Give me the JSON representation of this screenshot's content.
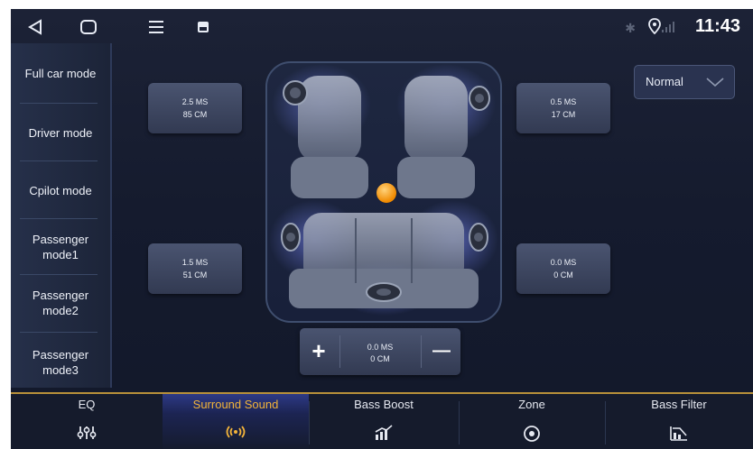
{
  "status_bar": {
    "time": "11:43",
    "back_icon": "back-triangle-icon",
    "home_icon": "home-square-icon",
    "menu_icon": "hamburger-menu-icon",
    "app_icon": "app-thumbnail-icon",
    "bluetooth_icon": "bluetooth-icon",
    "location_icon": "location-pin-icon",
    "signal_icon": "signal-bars-icon"
  },
  "sidebar": {
    "items": [
      {
        "label": "Full car mode"
      },
      {
        "label": "Driver mode"
      },
      {
        "label": "Cpilot mode"
      },
      {
        "label": "Passenger\nmode1"
      },
      {
        "label": "Passenger\nmode2"
      },
      {
        "label": "Passenger\nmode3"
      }
    ]
  },
  "delays": {
    "front_left": {
      "ms": "2.5 MS",
      "cm": "85 CM"
    },
    "front_right": {
      "ms": "0.5 MS",
      "cm": "17 CM"
    },
    "rear_left": {
      "ms": "1.5 MS",
      "cm": "51 CM"
    },
    "rear_right": {
      "ms": "0.0 MS",
      "cm": "0 CM"
    }
  },
  "preset": {
    "selected": "Normal"
  },
  "stepper": {
    "ms": "0.0 MS",
    "cm": "0 CM",
    "plus": "+",
    "minus": "—"
  },
  "tabs": [
    {
      "label": "EQ",
      "icon": "equalizer-sliders-icon"
    },
    {
      "label": "Surround Sound",
      "icon": "surround-waves-icon"
    },
    {
      "label": "Bass Boost",
      "icon": "bass-boost-chart-icon"
    },
    {
      "label": "Zone",
      "icon": "zone-target-icon"
    },
    {
      "label": "Bass Filter",
      "icon": "bass-filter-icon"
    }
  ],
  "colors": {
    "active_tab": "#f2b33a",
    "accent_line": "#b8913a",
    "focus_dot": "#f5a623",
    "speaker_glow": "#6d7cff"
  }
}
